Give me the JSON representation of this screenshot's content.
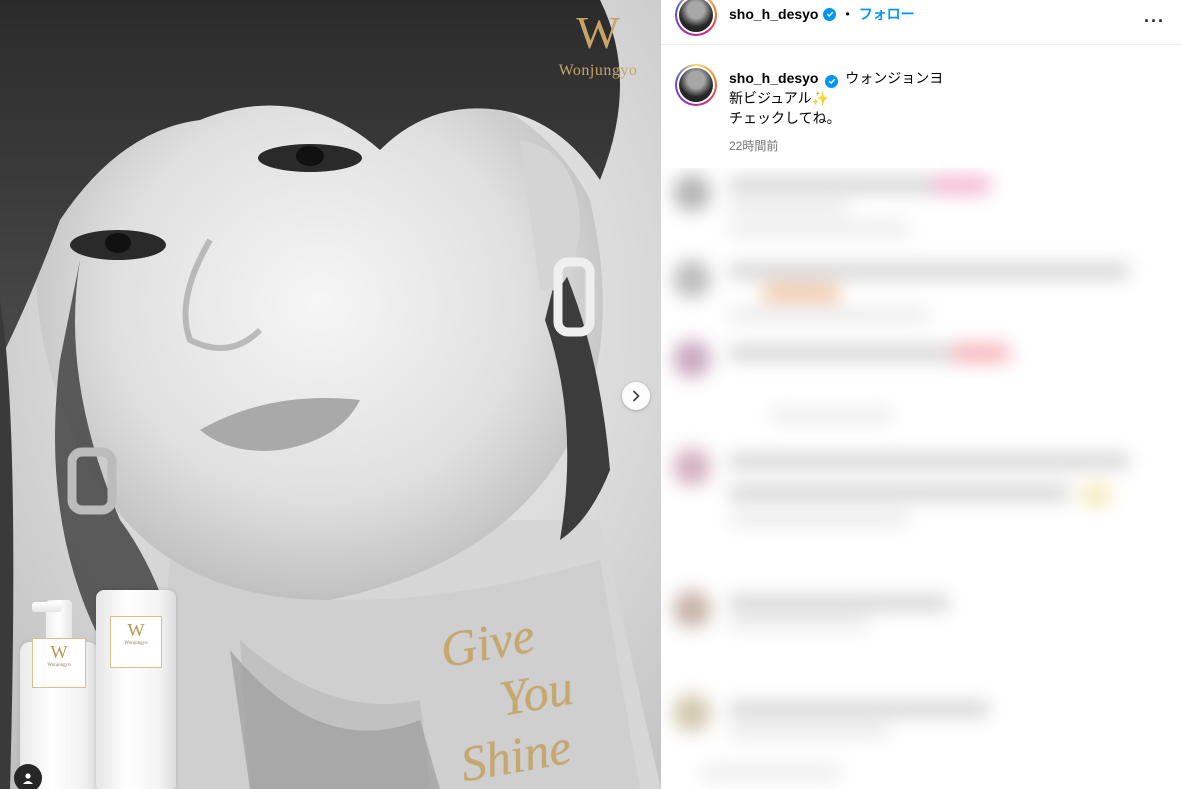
{
  "post": {
    "media": {
      "brand_logo_letter": "W",
      "brand_name": "Wonjungyo",
      "slogan": [
        "Give",
        "You",
        "Shine"
      ],
      "product_label_letter": "W",
      "product_label_name": "Wonjungyo",
      "next_icon": "chevron-right-icon",
      "tag_icon": "user-tag-icon"
    }
  },
  "header": {
    "username": "sho_h_desyo",
    "separator": "•",
    "follow_label": "フォロー",
    "more_icon": "more-options-icon",
    "more_label": "···"
  },
  "caption": {
    "username": "sho_h_desyo",
    "text_line1": "ウォンジョンヨ",
    "text_line2": "新ビジュアル✨",
    "text_line3": "チェックしてね。",
    "timestamp": "22時間前"
  },
  "colors": {
    "accent": "#0095f6",
    "gold": "#c7a564"
  }
}
